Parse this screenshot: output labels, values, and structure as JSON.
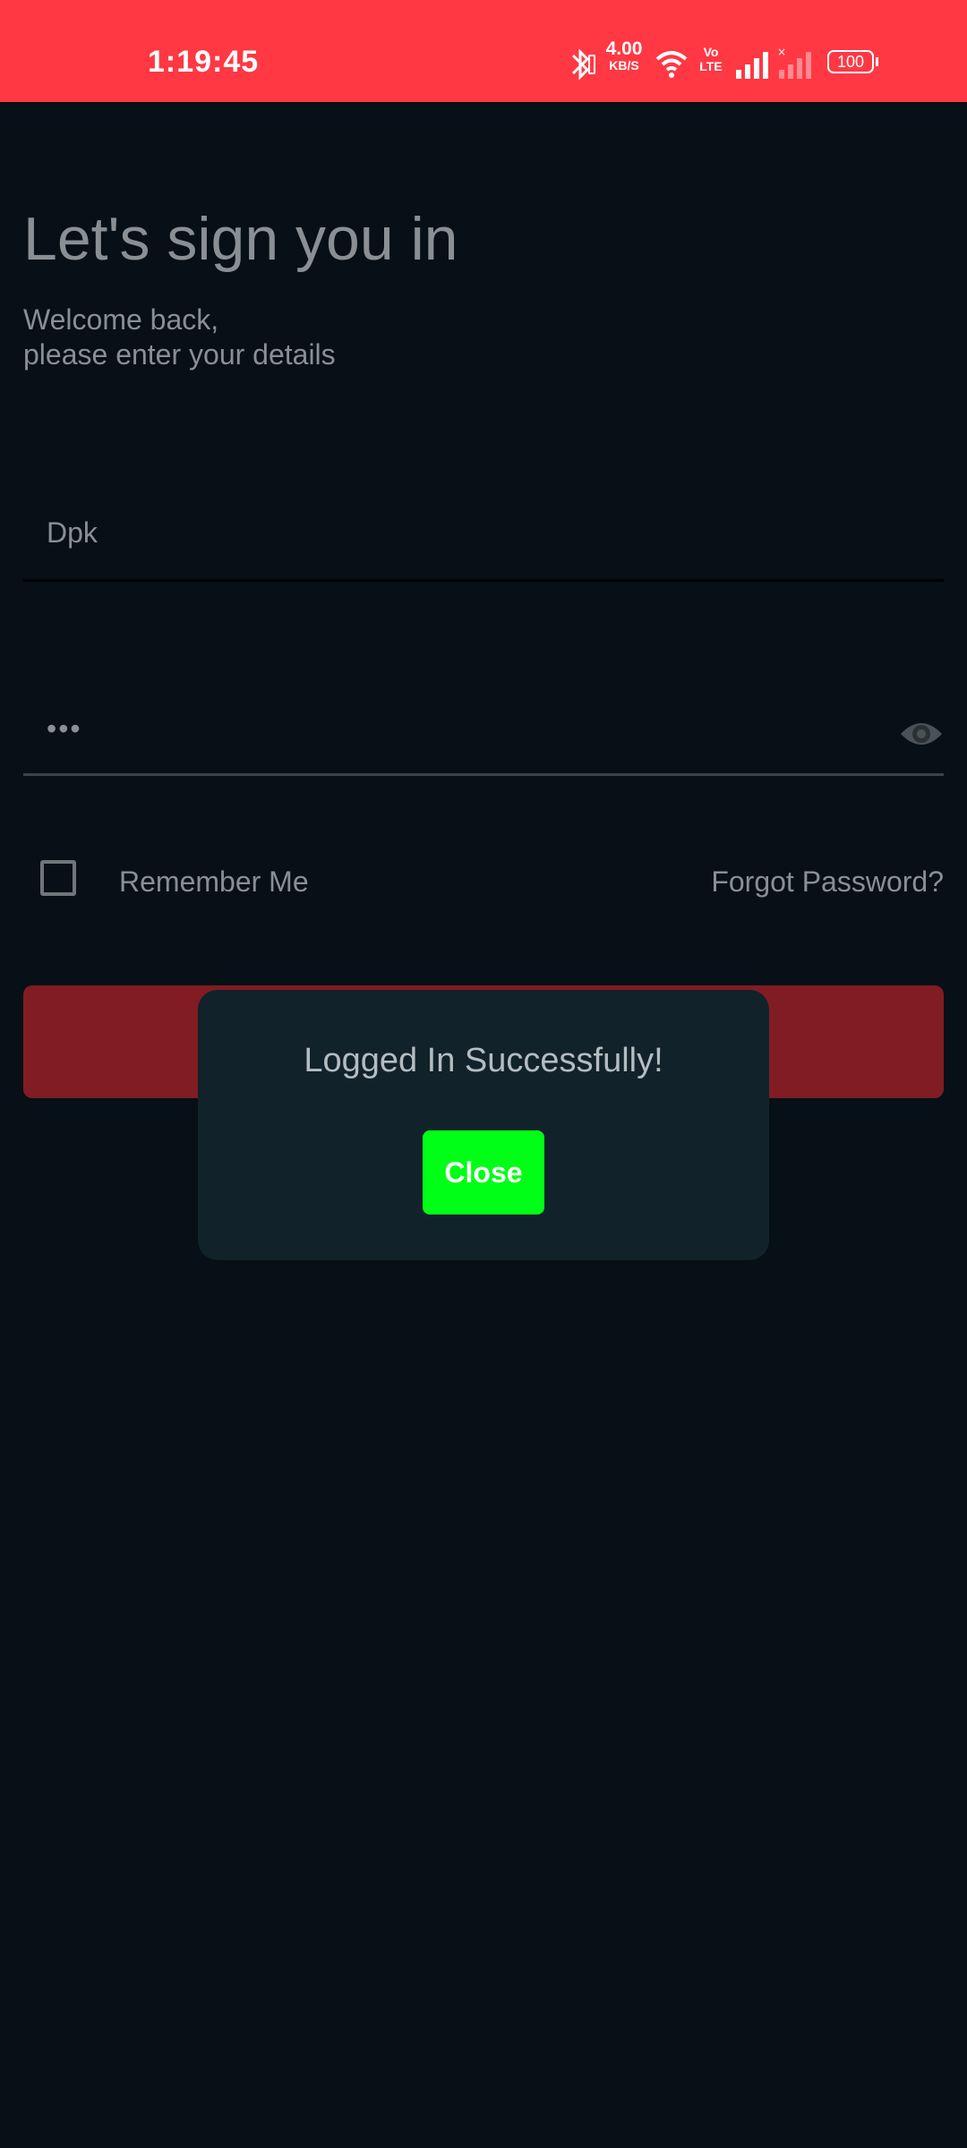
{
  "status_bar": {
    "time": "1:19:45",
    "network_speed_value": "4.00",
    "network_speed_unit": "KB/S",
    "volte_label": "Vo LTE",
    "battery_level": "100",
    "icons": [
      "bluetooth-icon",
      "wifi-icon",
      "volte-icon",
      "signal-icon",
      "signal-icon",
      "battery-icon"
    ]
  },
  "login": {
    "title": "Let's sign you in",
    "subtitle_line1": "Welcome back,",
    "subtitle_line2": "please enter your details",
    "username_value": "Dpk",
    "password_value": "•••",
    "show_password_icon": "eye-icon",
    "remember_me_label": "Remember Me",
    "remember_me_checked": false,
    "forgot_password_label": "Forgot Password?"
  },
  "dialog": {
    "message": "Logged In Successfully!",
    "close_label": "Close"
  },
  "colors": {
    "status_bar": "#ff3844",
    "background": "#061016",
    "sign_in_button": "#811c23",
    "dialog_bg": "#11222b",
    "close_button": "#00ff16"
  }
}
